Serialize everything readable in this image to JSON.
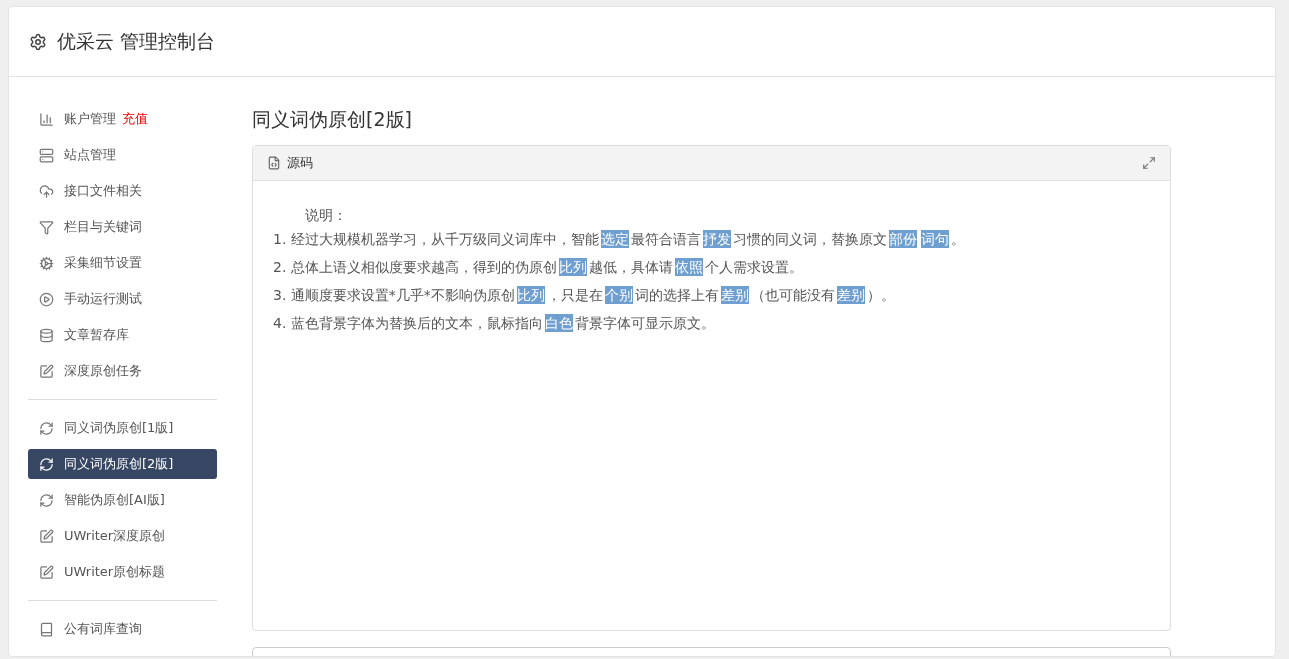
{
  "header": {
    "title": "优采云 管理控制台"
  },
  "sidebar": {
    "groups": [
      {
        "items": [
          {
            "label": "账户管理",
            "badge": "充值",
            "selected": false
          },
          {
            "label": "站点管理",
            "selected": false
          },
          {
            "label": "接口文件相关",
            "selected": false
          },
          {
            "label": "栏目与关键词",
            "selected": false
          },
          {
            "label": "采集细节设置",
            "selected": false
          },
          {
            "label": "手动运行测试",
            "selected": false
          },
          {
            "label": "文章暂存库",
            "selected": false
          },
          {
            "label": "深度原创任务",
            "selected": false
          }
        ]
      },
      {
        "items": [
          {
            "label": "同义词伪原创[1版]",
            "selected": false
          },
          {
            "label": "同义词伪原创[2版]",
            "selected": true
          },
          {
            "label": "智能伪原创[AI版]",
            "selected": false
          },
          {
            "label": "UWriter深度原创",
            "selected": false
          },
          {
            "label": "UWriter原创标题",
            "selected": false
          }
        ]
      },
      {
        "items": [
          {
            "label": "公有词库查询",
            "selected": false
          }
        ]
      }
    ]
  },
  "main": {
    "title": "同义词伪原创[2版]",
    "panel": {
      "tab": "源码",
      "intro": "说明：",
      "lines": [
        {
          "number": "1.",
          "segments": [
            {
              "text": "经过大规模机器学习，从千万级同义词库中，智能",
              "replaced": false
            },
            {
              "text": "选定",
              "replaced": true
            },
            {
              "text": "最符合语言",
              "replaced": false
            },
            {
              "text": "抒发",
              "replaced": true
            },
            {
              "text": "习惯的同义词，替换原文",
              "replaced": false
            },
            {
              "text": "部份",
              "replaced": true
            },
            {
              "text": "词句",
              "replaced": true
            },
            {
              "text": "。",
              "replaced": false
            }
          ]
        },
        {
          "number": "2.",
          "segments": [
            {
              "text": "总体上语义相似度要求越高，得到的伪原创",
              "replaced": false
            },
            {
              "text": "比列",
              "replaced": true
            },
            {
              "text": "越低，具体请",
              "replaced": false
            },
            {
              "text": "依照",
              "replaced": true
            },
            {
              "text": "个人需求设置。",
              "replaced": false
            }
          ]
        },
        {
          "number": "3.",
          "segments": [
            {
              "text": "通顺度要求设置*几乎*不影响伪原创",
              "replaced": false
            },
            {
              "text": "比列",
              "replaced": true
            },
            {
              "text": "，只是在",
              "replaced": false
            },
            {
              "text": "个别",
              "replaced": true
            },
            {
              "text": "词的选择上有",
              "replaced": false
            },
            {
              "text": "差别",
              "replaced": true
            },
            {
              "text": "（也可能没有",
              "replaced": false
            },
            {
              "text": "差别",
              "replaced": true
            },
            {
              "text": "）。",
              "replaced": false
            }
          ]
        },
        {
          "number": "4.",
          "segments": [
            {
              "text": "蓝色背景字体为替换后的文本，鼠标指向",
              "replaced": false
            },
            {
              "text": "白色",
              "replaced": true
            },
            {
              "text": "背景字体可显示原文。",
              "replaced": false
            }
          ]
        }
      ]
    }
  }
}
